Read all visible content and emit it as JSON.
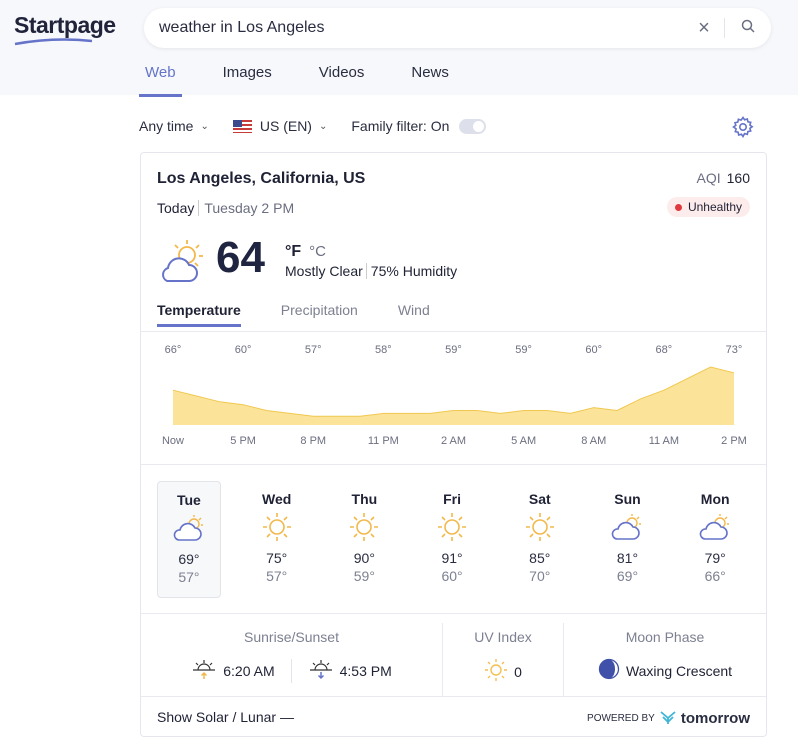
{
  "brand": {
    "logo": "Startpage"
  },
  "search": {
    "query": "weather in Los Angeles"
  },
  "nav_tabs": [
    {
      "label": "Web",
      "active": true
    },
    {
      "label": "Images"
    },
    {
      "label": "Videos"
    },
    {
      "label": "News"
    }
  ],
  "filters": {
    "time": "Any time",
    "region": "US (EN)",
    "family_filter": "Family filter: On"
  },
  "weather": {
    "location": "Los Angeles, California, US",
    "aqi_label": "AQI",
    "aqi_value": "160",
    "aqi_status": "Unhealthy",
    "aqi_color": "#e0393e",
    "today": "Today",
    "datetime": "Tuesday 2 PM",
    "temperature": "64",
    "unit_f": "°F",
    "unit_c": "°C",
    "condition": "Mostly Clear",
    "humidity": "75% Humidity",
    "tabs": [
      "Temperature",
      "Precipitation",
      "Wind"
    ],
    "forecast": [
      {
        "day": "Tue",
        "icon": "cloud",
        "hi": "69°",
        "lo": "57°"
      },
      {
        "day": "Wed",
        "icon": "sun",
        "hi": "75°",
        "lo": "57°"
      },
      {
        "day": "Thu",
        "icon": "sun",
        "hi": "90°",
        "lo": "59°"
      },
      {
        "day": "Fri",
        "icon": "sun",
        "hi": "91°",
        "lo": "60°"
      },
      {
        "day": "Sat",
        "icon": "sun",
        "hi": "85°",
        "lo": "70°"
      },
      {
        "day": "Sun",
        "icon": "cloud",
        "hi": "81°",
        "lo": "69°"
      },
      {
        "day": "Mon",
        "icon": "cloud",
        "hi": "79°",
        "lo": "66°"
      }
    ],
    "sun_title": "Sunrise/Sunset",
    "sunrise": "6:20 AM",
    "sunset": "4:53 PM",
    "uv_title": "UV Index",
    "uv": "0",
    "moon_title": "Moon Phase",
    "moon": "Waxing Crescent",
    "show_solar": "Show Solar / Lunar —",
    "powered_by": "POWERED BY",
    "provider": "tomorrow"
  },
  "chart_data": {
    "type": "area",
    "x_labels": [
      "Now",
      "5 PM",
      "8 PM",
      "11 PM",
      "2 AM",
      "5 AM",
      "8 AM",
      "11 AM",
      "2 PM"
    ],
    "value_labels": [
      "66°",
      "60°",
      "57°",
      "58°",
      "59°",
      "59°",
      "60°",
      "68°",
      "73°"
    ],
    "hourly": [
      66,
      64,
      62,
      61,
      59,
      58,
      57,
      57,
      57,
      58,
      58,
      58,
      59,
      59,
      58,
      59,
      59,
      58,
      60,
      59,
      63,
      66,
      70,
      74,
      72
    ],
    "color": "#fbe39a",
    "stroke": "#f0c850"
  }
}
